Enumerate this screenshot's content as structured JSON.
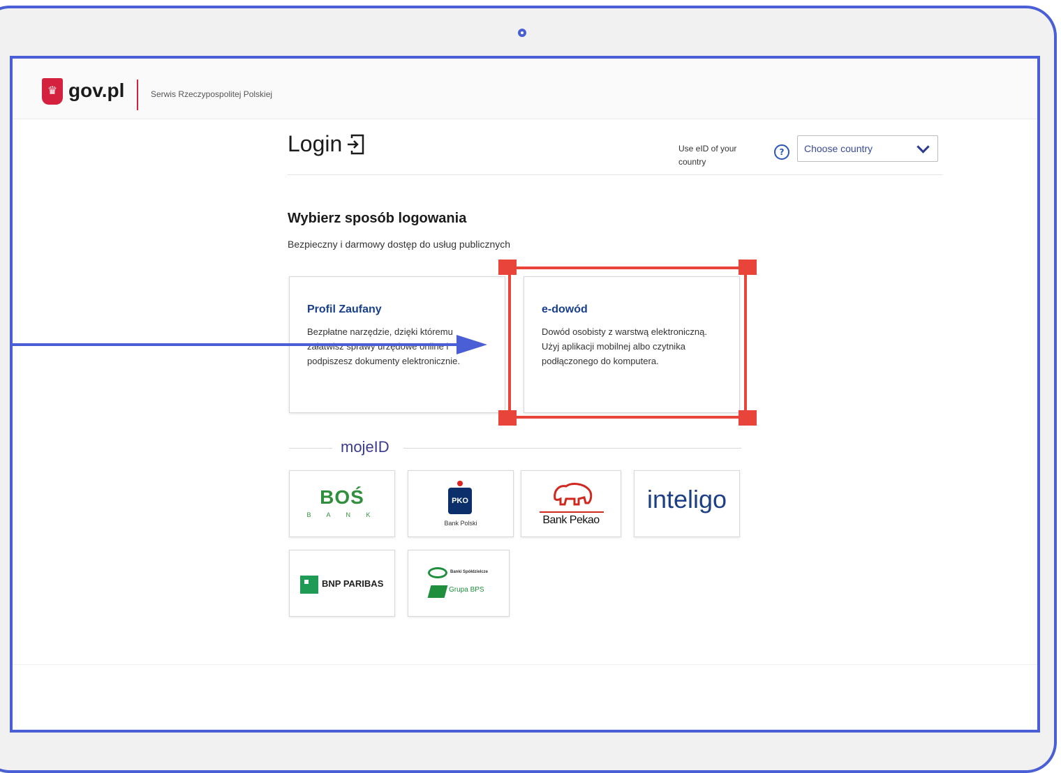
{
  "header": {
    "brand": "gov.pl",
    "subtitle": "Serwis Rzeczypospolitej Polskiej"
  },
  "login": {
    "title": "Login",
    "eid_label": "Use eID of your country",
    "help": "?",
    "country_placeholder": "Choose country"
  },
  "section": {
    "title": "Wybierz sposób logowania",
    "subtitle": "Bezpieczny i darmowy dostęp do usług publicznych"
  },
  "cards": [
    {
      "title": "Profil Zaufany",
      "description": "Bezpłatne narzędzie, dzięki któremu załatwisz sprawy urzędowe online i podpiszesz dokumenty elektronicznie."
    },
    {
      "title": "e-dowód",
      "description": "Dowód osobisty z warstwą elektroniczną. Użyj aplikacji mobilnej albo czytnika podłączonego do komputera."
    }
  ],
  "mojeid": {
    "label": "mojeID",
    "banks": [
      {
        "name": "BOŚ",
        "sub": "B A N K"
      },
      {
        "name": "PKO",
        "sub": "Bank Polski"
      },
      {
        "name": "Bank Pekao"
      },
      {
        "name": "inteligo"
      },
      {
        "name": "BNP PARIBAS"
      },
      {
        "name": "Banki Spółdzielcze",
        "sub": "Grupa BPS"
      }
    ]
  },
  "colors": {
    "frame": "#4a5fd6",
    "highlight": "#e8443a",
    "link_title": "#173f8c",
    "gov_red": "#d4213d"
  },
  "icons": [
    "poland-emblem-icon",
    "login-icon",
    "help-icon",
    "chevron-down-icon",
    "arrow-right-icon"
  ]
}
